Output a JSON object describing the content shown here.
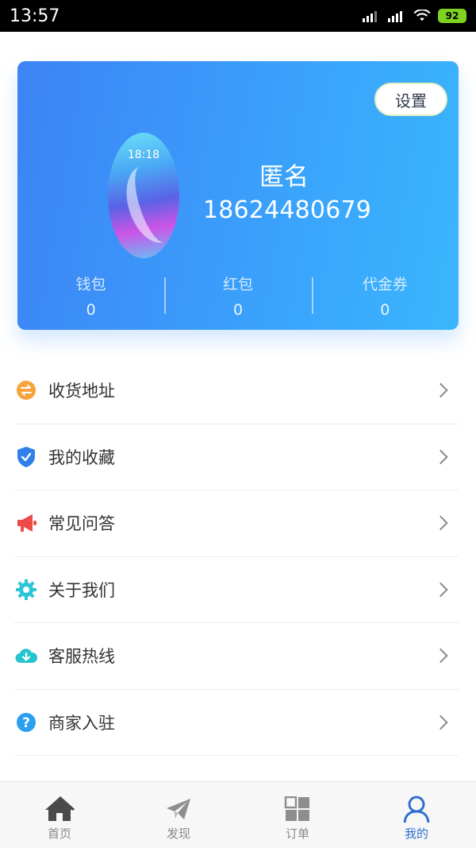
{
  "status_bar": {
    "time": "13:57",
    "battery": "92"
  },
  "profile": {
    "settings_label": "设置",
    "avatar_time": "18:18",
    "name": "匿名",
    "phone": "18624480679",
    "stats": [
      {
        "label": "钱包",
        "value": "0"
      },
      {
        "label": "红包",
        "value": "0"
      },
      {
        "label": "代金券",
        "value": "0"
      }
    ]
  },
  "menu": [
    {
      "label": "收货地址",
      "icon": "exchange-icon",
      "color": "#f6a43b"
    },
    {
      "label": "我的收藏",
      "icon": "shield-check-icon",
      "color": "#2f80ed"
    },
    {
      "label": "常见问答",
      "icon": "megaphone-icon",
      "color": "#ef4a4a"
    },
    {
      "label": "关于我们",
      "icon": "gear-icon",
      "color": "#2ec5d6"
    },
    {
      "label": "客服热线",
      "icon": "cloud-download-icon",
      "color": "#26c4cc"
    },
    {
      "label": "商家入驻",
      "icon": "question-circle-icon",
      "color": "#2a9ff0"
    }
  ],
  "tabs": [
    {
      "label": "首页",
      "icon": "home-icon"
    },
    {
      "label": "发现",
      "icon": "paper-plane-icon"
    },
    {
      "label": "订单",
      "icon": "grid-icon"
    },
    {
      "label": "我的",
      "icon": "user-icon",
      "active": true
    }
  ],
  "colors": {
    "accent": "#2f6fd1",
    "card_start": "#3d83f5",
    "card_end": "#3ab6fd"
  }
}
